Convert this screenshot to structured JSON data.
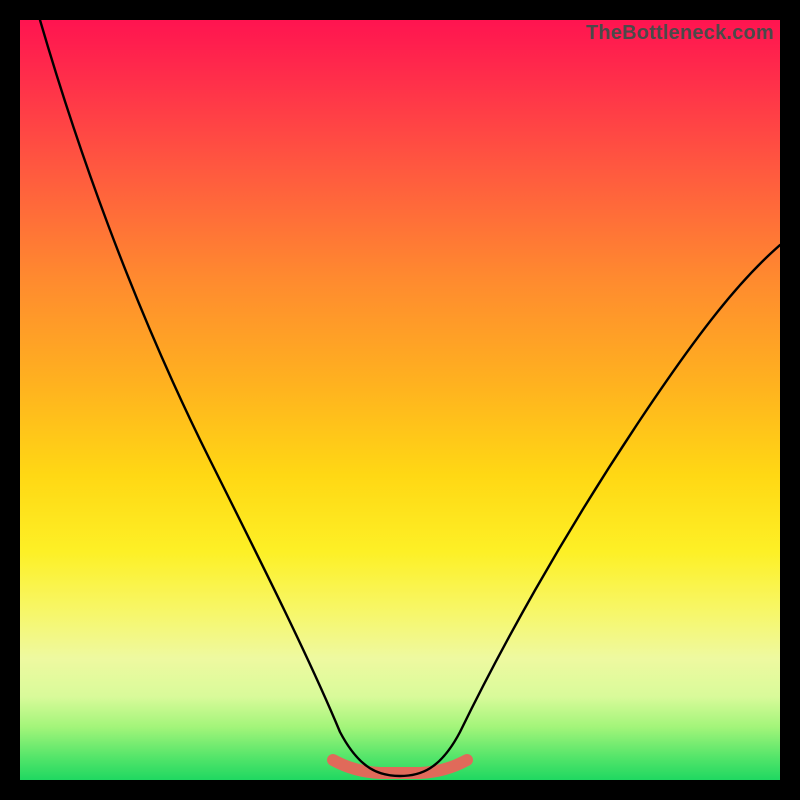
{
  "watermark": "TheBottleneck.com",
  "colors": {
    "frame": "#000000",
    "curve": "#000000",
    "bottom_segment": "#e06a5a",
    "watermark_text": "#4a4a4a"
  },
  "chart_data": {
    "type": "line",
    "title": "",
    "xlabel": "",
    "ylabel": "",
    "xlim": [
      0,
      100
    ],
    "ylim": [
      0,
      100
    ],
    "series": [
      {
        "name": "bottleneck-curve",
        "x": [
          0,
          5,
          10,
          15,
          20,
          25,
          30,
          35,
          40,
          42,
          45,
          48,
          51,
          54,
          56,
          58,
          62,
          68,
          75,
          82,
          90,
          100
        ],
        "y": [
          100,
          94,
          85,
          77,
          68,
          59,
          50,
          40,
          27,
          20,
          10,
          3,
          1,
          1,
          3,
          6,
          13,
          22,
          33,
          44,
          56,
          70
        ]
      }
    ],
    "annotations": [
      {
        "name": "optimal-band",
        "x_range": [
          42,
          58
        ],
        "note": "flat low region highlighted"
      }
    ]
  }
}
